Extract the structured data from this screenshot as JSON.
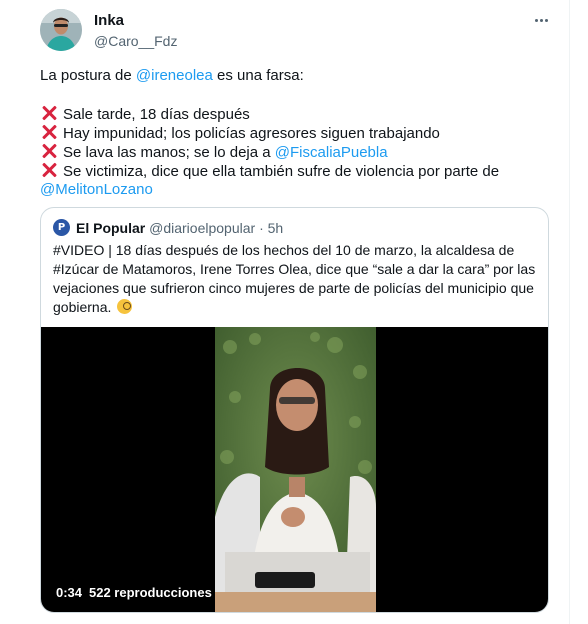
{
  "author": {
    "name": "Inka",
    "handle": "@Caro__Fdz"
  },
  "tweet": {
    "line1_prefix": "La postura de ",
    "line1_mention": "@ireneolea",
    "line1_suffix": " es una farsa:",
    "point1": "Sale tarde, 18 días después",
    "point2": "Hay impunidad; los policías agresores siguen trabajando",
    "point3_prefix": "Se lava las manos; se lo deja a ",
    "point3_mention": "@FiscaliaPuebla",
    "point4": "Se victimiza, dice que ella también sufre de violencia por parte de",
    "point4_mention": "@MelitonLozano"
  },
  "quote": {
    "logo_letter": "P",
    "name": "El Popular",
    "handle": "@diarioelpopular",
    "separator": "·",
    "time": "5h",
    "line1": "#VIDEO | 18 días después de los hechos del 10 de marzo, la alcaldesa de",
    "line2": "#Izúcar de Matamoros, Irene Torres Olea, dice que “sale a dar la cara” por las",
    "line3": "vejaciones que sufrieron cinco mujeres de parte de policías del municipio que",
    "line4": "gobierna."
  },
  "video": {
    "duration": "0:34",
    "views": "522 reproducciones"
  },
  "icons": {
    "more": "more-dots-icon",
    "cross": "cross-mark-icon",
    "emoji": "face-with-monocle-icon"
  },
  "colors": {
    "link": "#1d9bf0",
    "cross": "#d8233f",
    "secondary_text": "#536471",
    "border": "#cfd9de"
  }
}
